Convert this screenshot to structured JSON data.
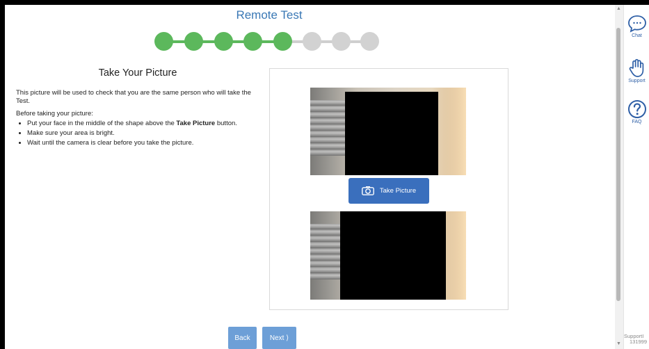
{
  "header": {
    "title": "Remote Test"
  },
  "progress": {
    "completed_steps": 5,
    "total_steps": 8
  },
  "instructions": {
    "heading": "Take Your Picture",
    "intro": "This picture will be used to check that you are the same person who will take the Test.",
    "before_label": "Before taking your picture:",
    "bullet1_pre": "Put your face in the middle of the shape above the ",
    "bullet1_bold": "Take Picture",
    "bullet1_post": " button.",
    "bullet2": "Make sure your area is bright.",
    "bullet3": "Wait until the camera is clear before you take the picture."
  },
  "camera": {
    "take_picture_label": "Take Picture",
    "camera_icon": "camera-icon"
  },
  "nav": {
    "back_label": "Back",
    "next_label": "Next ⟩"
  },
  "sidebar": {
    "chat_label": "Chat",
    "chat_icon": "chat-bubble-icon",
    "support_label": "Support",
    "support_icon": "hand-icon",
    "faq_label": "FAQ",
    "faq_icon": "question-circle-icon",
    "footer_line1": "SupportI",
    "footer_line2": "131999"
  },
  "colors": {
    "accent": "#3a6fbd",
    "step_done": "#5cb85c",
    "step_todo": "#d2d2d2",
    "title": "#3a78b5"
  }
}
